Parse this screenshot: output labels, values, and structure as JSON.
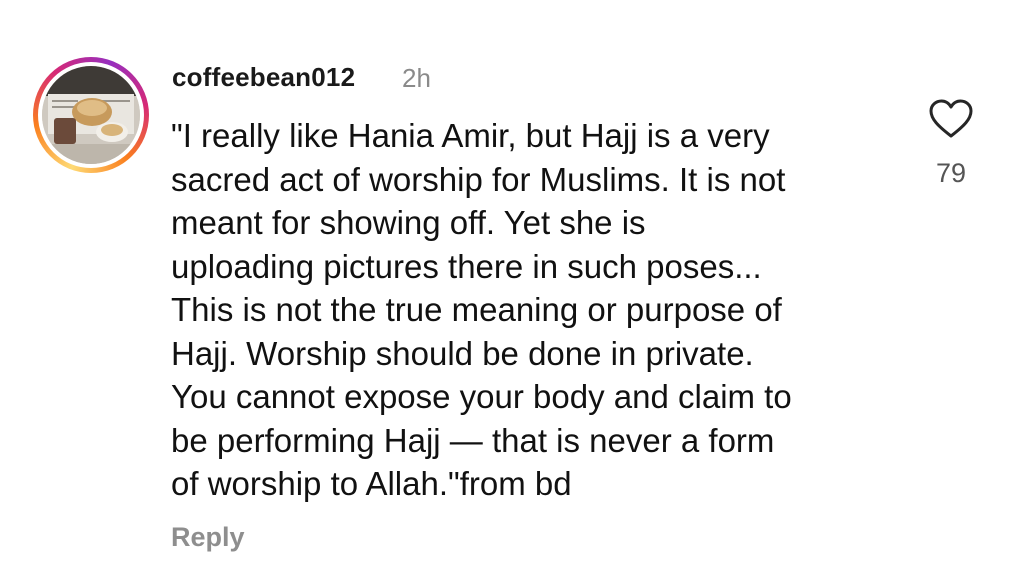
{
  "comment": {
    "username": "coffeebean012",
    "time_ago": "2h",
    "text": "\"I really like Hania Amir, but Hajj is a very\nsacred act of worship for Muslims. It is not\nmeant for showing off. Yet she is\nuploading pictures there in such poses...\nThis is not the true meaning or purpose of\nHajj. Worship should be done in private.\nYou cannot expose your body and claim to\nbe performing Hajj — that is never a form\nof worship to Allah.\"from bd",
    "like_count": "79",
    "reply_label": "Reply",
    "like_icon": "heart-outline-icon",
    "avatar_ring_colors": [
      "#feda75",
      "#fa7e1e",
      "#d62976",
      "#962fbf"
    ]
  }
}
